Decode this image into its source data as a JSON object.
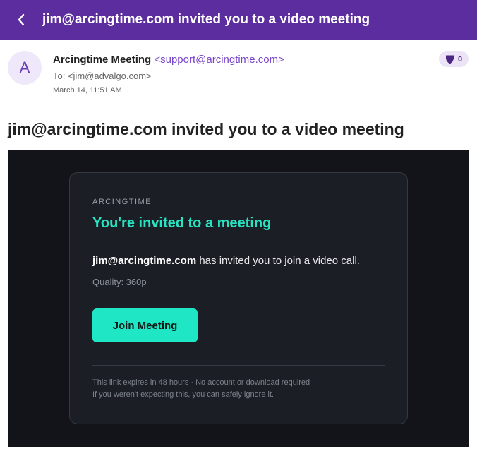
{
  "topbar": {
    "back_icon": "chevron-left-icon",
    "title": "jim@arcingtime.com invited you to a video meeting"
  },
  "header": {
    "avatar_letter": "A",
    "sender_name": "Arcingtime Meeting",
    "sender_email": "<support@arcingtime.com>",
    "to_line": "To: <jim@advalgo.com>",
    "date": "March 14, 11:51 AM",
    "shield_icon": "shield-icon",
    "shield_count": "0"
  },
  "subject": "jim@arcingtime.com invited you to a video meeting",
  "email": {
    "brand": "ARCINGTIME",
    "headline": "You're invited to a meeting",
    "inviter": "jim@arcingtime.com",
    "invite_rest": " has invited you to join a video call.",
    "quality": "Quality: 360p",
    "join_label": "Join Meeting",
    "footer_line1": "This link expires in 48 hours · No account or download required",
    "footer_line2": "If you weren't expecting this, you can safely ignore it."
  },
  "colors": {
    "topbar": "#5b2d9e",
    "accent_teal": "#1fe6c4",
    "email_background": "#12141a",
    "card_background": "#1b1e25"
  }
}
